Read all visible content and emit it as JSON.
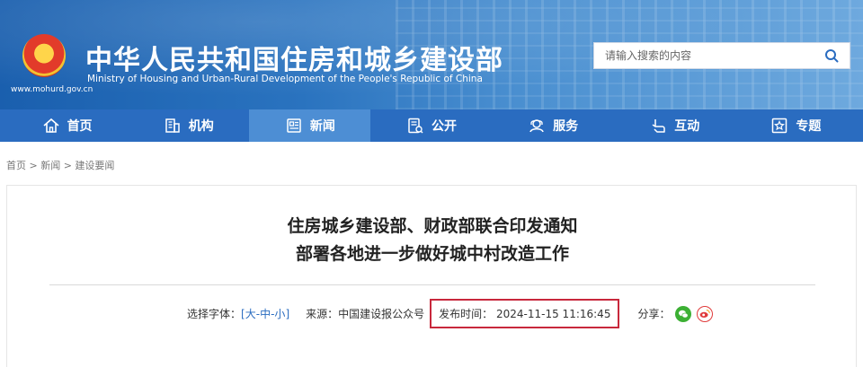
{
  "header": {
    "title": "中华人民共和国住房和城乡建设部",
    "subtitle": "Ministry of Housing and Urban-Rural Development of the People's Republic of China",
    "domain": "www.mohurd.gov.cn",
    "search_placeholder": "请输入搜索的内容"
  },
  "nav": {
    "items": [
      {
        "label": "首页",
        "icon": "home-icon"
      },
      {
        "label": "机构",
        "icon": "building-icon"
      },
      {
        "label": "新闻",
        "icon": "news-icon",
        "active": true
      },
      {
        "label": "公开",
        "icon": "disclosure-icon"
      },
      {
        "label": "服务",
        "icon": "service-icon"
      },
      {
        "label": "互动",
        "icon": "interaction-icon"
      },
      {
        "label": "专题",
        "icon": "topic-icon"
      }
    ]
  },
  "breadcrumb": {
    "items": [
      "首页",
      "新闻",
      "建设要闻"
    ],
    "separator": ">"
  },
  "article": {
    "title_line1": "住房城乡建设部、财政部联合印发通知",
    "title_line2": "部署各地进一步做好城中村改造工作",
    "font_size_label": "选择字体：",
    "font_size_options": [
      "大",
      "中",
      "小"
    ],
    "source_label": "来源：",
    "source": "中国建设报公众号",
    "publish_label": "发布时间：",
    "publish_time": "2024-11-15 11:16:45",
    "share_label": "分享："
  },
  "colors": {
    "nav_bg": "#2a6cc0",
    "nav_active": "#4d8ed4",
    "highlight_border": "#c8283c",
    "link": "#2a6cc0"
  }
}
